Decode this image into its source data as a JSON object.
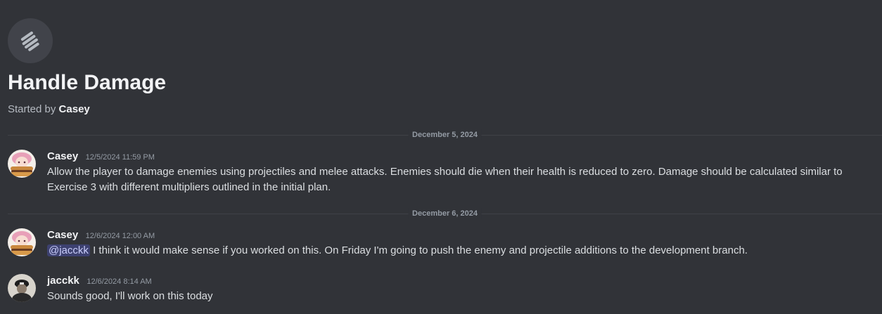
{
  "thread": {
    "title": "Handle Damage",
    "started_by_label": "Started by",
    "started_by_user": "Casey"
  },
  "dividers": [
    {
      "date": "December 5, 2024"
    },
    {
      "date": "December 6, 2024"
    }
  ],
  "messages": [
    {
      "username": "Casey",
      "timestamp": "12/5/2024 11:59 PM",
      "text": "Allow the player to damage enemies using projectiles and melee attacks. Enemies should die when their health is reduced to zero. Damage should be calculated similar to Exercise 3 with different multipliers outlined in the initial plan."
    },
    {
      "username": "Casey",
      "timestamp": "12/6/2024 12:00 AM",
      "mention": "@jacckk",
      "text": " I think it would make sense if you worked on this. On Friday I'm going to push the enemy and projectile additions to the development branch."
    },
    {
      "username": "jacckk",
      "timestamp": "12/6/2024 8:14 AM",
      "text": "Sounds good, I'll work on this today"
    }
  ],
  "colors": {
    "background": "#313338",
    "mention_bg": "#3c4270",
    "mention_text": "#c9cdfb"
  },
  "icons": {
    "thread": "thread-icon",
    "avatar_casey": "avatar-casey",
    "avatar_jacckk": "avatar-jacckk"
  }
}
